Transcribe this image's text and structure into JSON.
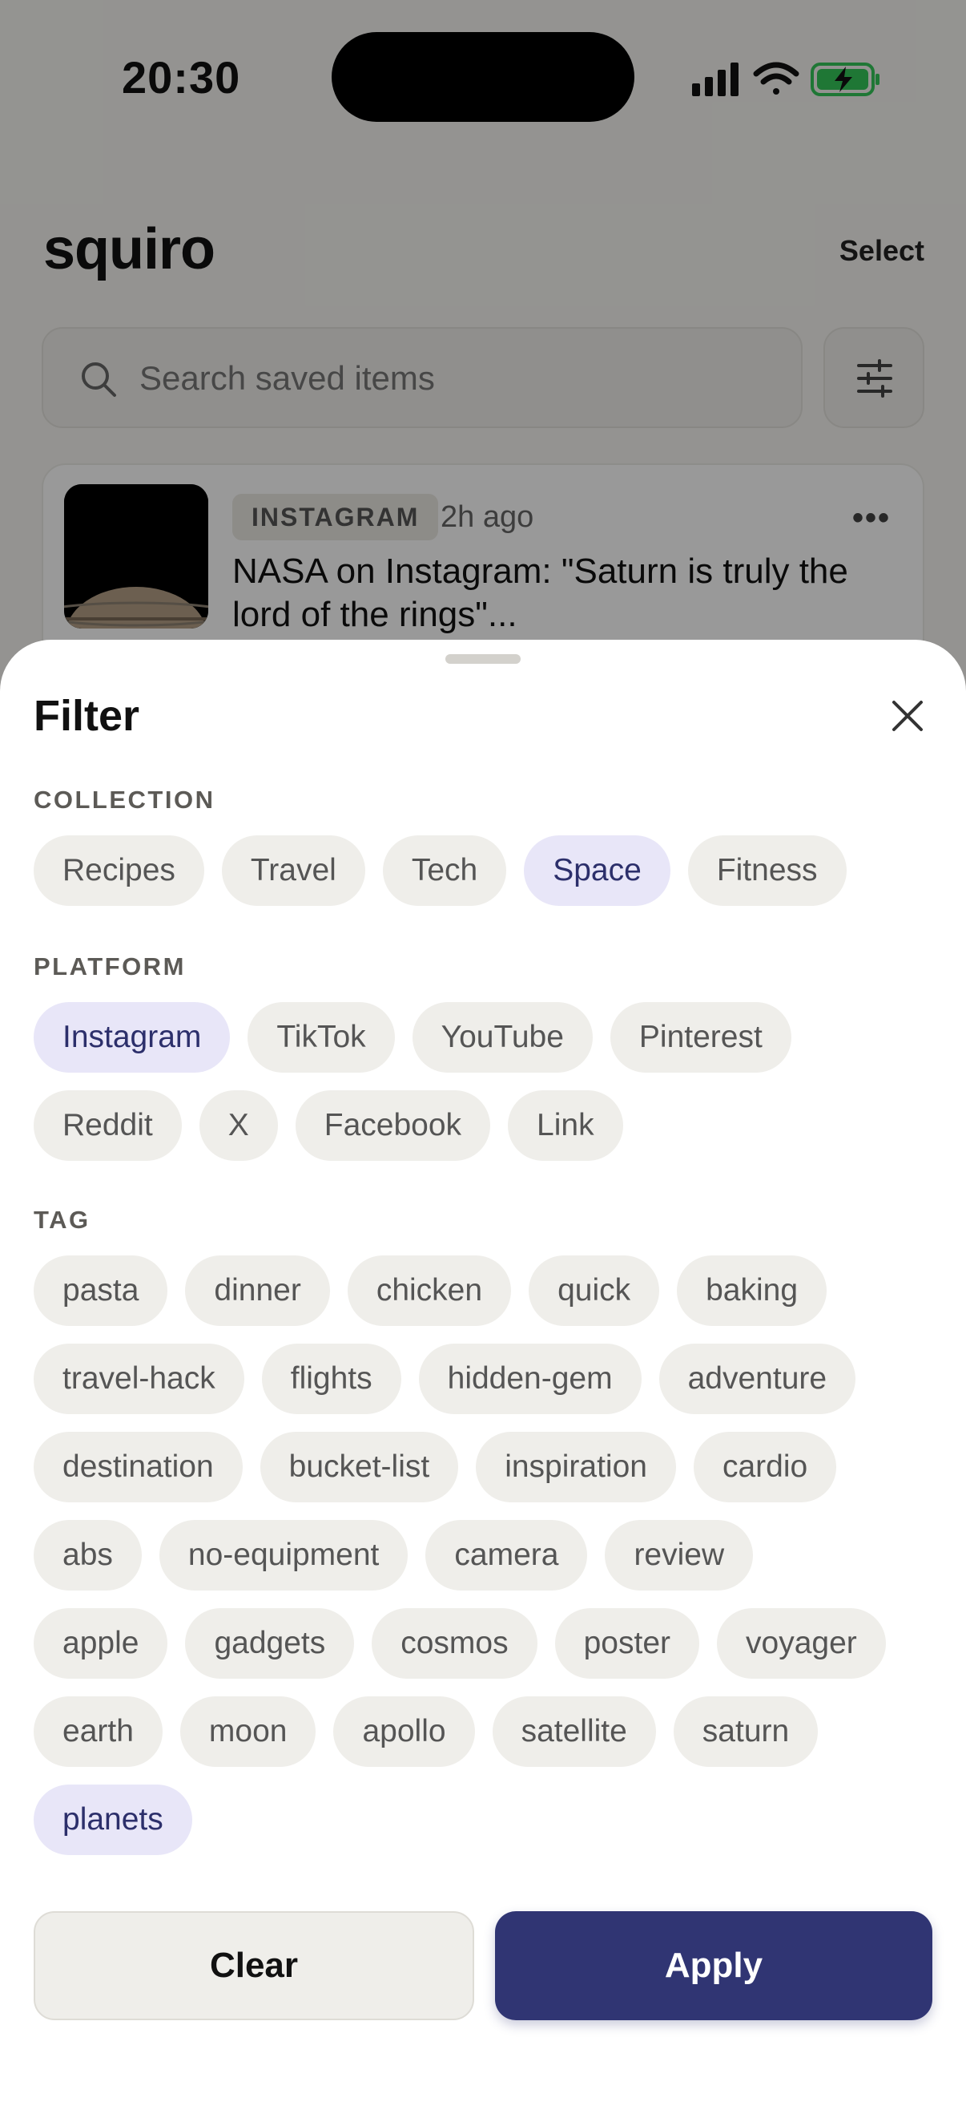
{
  "status_bar": {
    "time": "20:30"
  },
  "header": {
    "app_name": "squiro",
    "select_label": "Select"
  },
  "search": {
    "placeholder": "Search saved items"
  },
  "card": {
    "platform_badge": "INSTAGRAM",
    "time_ago": "2h ago",
    "more_label": "•••",
    "title": "NASA on Instagram: \"Saturn is truly the lord of the rings\"..."
  },
  "filter_sheet": {
    "title": "Filter",
    "sections": {
      "collection": {
        "label": "COLLECTION",
        "chips": [
          {
            "label": "Recipes",
            "selected": false
          },
          {
            "label": "Travel",
            "selected": false
          },
          {
            "label": "Tech",
            "selected": false
          },
          {
            "label": "Space",
            "selected": true
          },
          {
            "label": "Fitness",
            "selected": false
          }
        ]
      },
      "platform": {
        "label": "PLATFORM",
        "chips": [
          {
            "label": "Instagram",
            "selected": true
          },
          {
            "label": "TikTok",
            "selected": false
          },
          {
            "label": "YouTube",
            "selected": false
          },
          {
            "label": "Pinterest",
            "selected": false
          },
          {
            "label": "Reddit",
            "selected": false
          },
          {
            "label": "X",
            "selected": false
          },
          {
            "label": "Facebook",
            "selected": false
          },
          {
            "label": "Link",
            "selected": false
          }
        ]
      },
      "tag": {
        "label": "TAG",
        "chips": [
          {
            "label": "pasta",
            "selected": false
          },
          {
            "label": "dinner",
            "selected": false
          },
          {
            "label": "chicken",
            "selected": false
          },
          {
            "label": "quick",
            "selected": false
          },
          {
            "label": "baking",
            "selected": false
          },
          {
            "label": "travel-hack",
            "selected": false
          },
          {
            "label": "flights",
            "selected": false
          },
          {
            "label": "hidden-gem",
            "selected": false
          },
          {
            "label": "adventure",
            "selected": false
          },
          {
            "label": "destination",
            "selected": false
          },
          {
            "label": "bucket-list",
            "selected": false
          },
          {
            "label": "inspiration",
            "selected": false
          },
          {
            "label": "cardio",
            "selected": false
          },
          {
            "label": "abs",
            "selected": false
          },
          {
            "label": "no-equipment",
            "selected": false
          },
          {
            "label": "camera",
            "selected": false
          },
          {
            "label": "review",
            "selected": false
          },
          {
            "label": "apple",
            "selected": false
          },
          {
            "label": "gadgets",
            "selected": false
          },
          {
            "label": "cosmos",
            "selected": false
          },
          {
            "label": "poster",
            "selected": false
          },
          {
            "label": "voyager",
            "selected": false
          },
          {
            "label": "earth",
            "selected": false
          },
          {
            "label": "moon",
            "selected": false
          },
          {
            "label": "apollo",
            "selected": false
          },
          {
            "label": "satellite",
            "selected": false
          },
          {
            "label": "saturn",
            "selected": false
          },
          {
            "label": "planets",
            "selected": true
          }
        ]
      }
    },
    "clear_label": "Clear",
    "apply_label": "Apply"
  },
  "colors": {
    "accent": "#303573",
    "chip_selected_bg": "#e8e6f8",
    "chip_bg": "#efeeea",
    "battery_green": "#34c759"
  }
}
